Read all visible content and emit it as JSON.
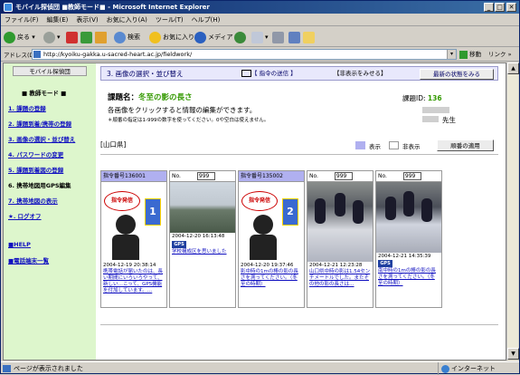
{
  "window": {
    "title": "モバイル探偵団 ■教師モード■ - Microsoft Internet Explorer"
  },
  "menu": [
    "ファイル(F)",
    "編集(E)",
    "表示(V)",
    "お気に入り(A)",
    "ツール(T)",
    "ヘルプ(H)"
  ],
  "toolbar": {
    "back": "戻る",
    "search": "検索",
    "favorites": "お気に入り",
    "media": "メディア"
  },
  "address": {
    "label": "アドレス(D)",
    "url": "http://kyoiku-gakka.u-sacred-heart.ac.jp/fieldwork/",
    "go": "移動",
    "links": "リンク"
  },
  "sidebar": {
    "system": "モバイル探偵団",
    "mode": "■ 教師モード ■",
    "items": [
      "1. 課題の登録",
      "2. 課題到着/携帯の登録",
      "3. 画像の選択・並び替え",
      "4. パスワードの変更",
      "5. 課題到着図の登録",
      "6. 携帯地図用GPS編集",
      "7. 携帯地図の表示",
      "★. ログオフ",
      "■HELP",
      "■電話端末一覧"
    ]
  },
  "main": {
    "step": "3. 画像の選択・並び替え",
    "send_button": "【 指令の送信 】",
    "hide_button": "【非表示をみせる】",
    "refresh_button": "最新の状態をみる",
    "task_label": "課題名：",
    "task_name": "冬至の影の長さ",
    "task_id_label": "課題ID:",
    "task_id": "136",
    "teacher": "先生",
    "instruction": "各画像をクリックすると情報の編集ができます。",
    "note": "＊順番の指定は1-999の数字を使ってください。0や空白は使えません。",
    "prefecture": "[山口県]",
    "legend_show": "表示",
    "legend_hide": "非表示",
    "apply_button": "順番の適用"
  },
  "cards": [
    {
      "id": "指令番号136001",
      "badge": "指令発信",
      "num": "1",
      "date": "2004-12-19 20:38:14",
      "text": "携帯電話が届いたのは、長い期間にいろいろやって、新しい…こって、GPS機能を付加しています。…"
    },
    {
      "label": "No.",
      "order": "999",
      "caption": "2004-12-20 16:13:48",
      "gps": "GPS",
      "text": "学校構成区を思いました"
    },
    {
      "id": "指令番号135002",
      "badge": "指令発信",
      "num": "2",
      "date": "2004-12-20 19:37:46",
      "text": "影中時の1mの棒の影の長さを測ってください。（冬至の時期）"
    },
    {
      "label": "No.",
      "order": "999",
      "date": "2004-12-21 12:23:28",
      "text": "山口県中時の影は1.54センチメートルでした。またその他の影の長さは…"
    },
    {
      "label": "No.",
      "order": "999",
      "gps": "GPS",
      "date": "2004-12-21 14:35:39",
      "text": "南中時の1mの棒の影の長さを測ってください。（冬至の時期）"
    }
  ],
  "status": {
    "left": "ページが表示されました",
    "right": "インターネット"
  },
  "colors": {
    "sidebar": "#ddf6cc",
    "show": "#b0b0f0",
    "hide": "#ffffff",
    "link": "#1010c0",
    "task": "#339900"
  }
}
